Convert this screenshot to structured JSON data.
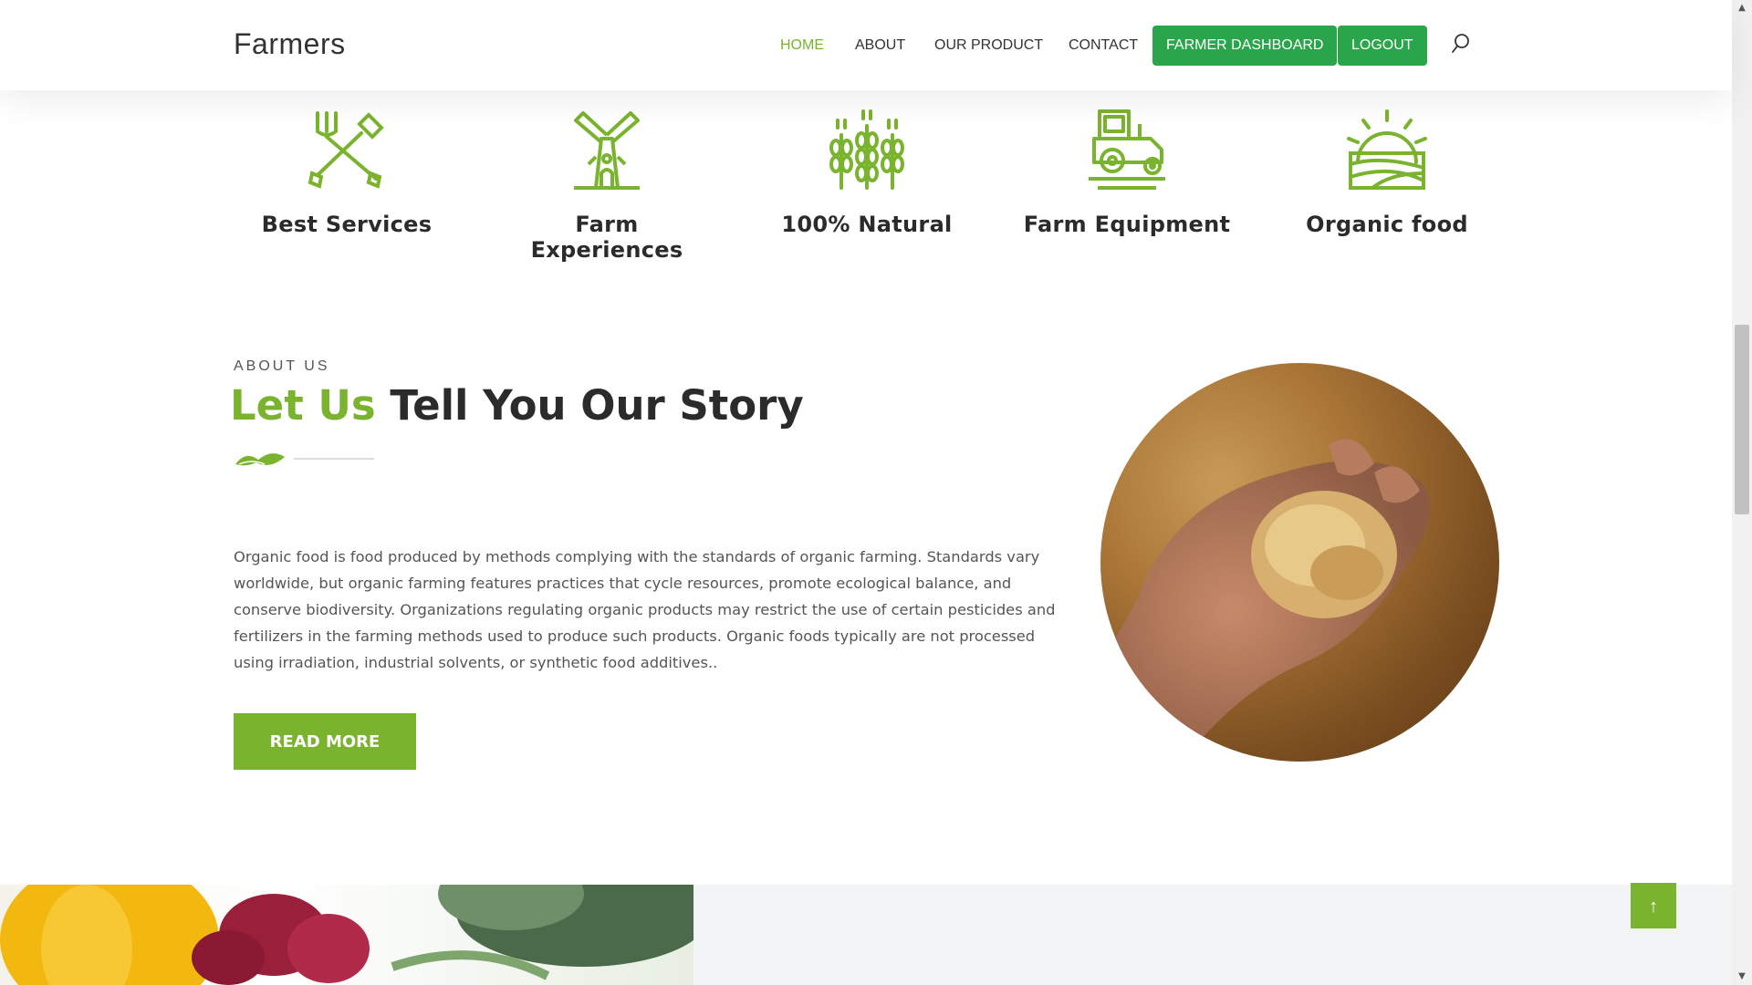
{
  "header": {
    "brand": "Farmers",
    "nav": [
      {
        "label": "HOME",
        "active": true
      },
      {
        "label": "ABOUT"
      },
      {
        "label": "OUR PRODUCT"
      },
      {
        "label": "CONTACT"
      }
    ],
    "buttons": {
      "dashboard": "FARMER DASHBOARD",
      "logout": "LOGOUT"
    },
    "search_icon": "search-icon"
  },
  "features": [
    {
      "title": "Best Services",
      "icon": "tools-icon"
    },
    {
      "title": "Farm Experiences",
      "icon": "windmill-icon"
    },
    {
      "title": "100% Natural",
      "icon": "wheat-icon"
    },
    {
      "title": "Farm Equipment",
      "icon": "tractor-icon"
    },
    {
      "title": "Organic food",
      "icon": "sunrise-field-icon"
    }
  ],
  "about": {
    "label": "ABOUT US",
    "title_highlight": "Let Us",
    "title_rest": " Tell You Our Story",
    "text": "Organic food is food produced by methods complying with the standards of organic farming. Standards vary worldwide, but organic farming features practices that cycle resources, promote ecological balance, and conserve biodiversity. Organizations regulating organic products may restrict the use of certain pesticides and fertilizers in the farming methods used to produce such products. Organic foods typically are not processed using irradiation, industrial solvents, or synthetic food additives..",
    "button": "READ MORE"
  },
  "scroll_top": {
    "label": "↑"
  },
  "colors": {
    "accent": "#7ab32e",
    "button_green": "#2aa54b",
    "heading": "#2b2b2b"
  }
}
